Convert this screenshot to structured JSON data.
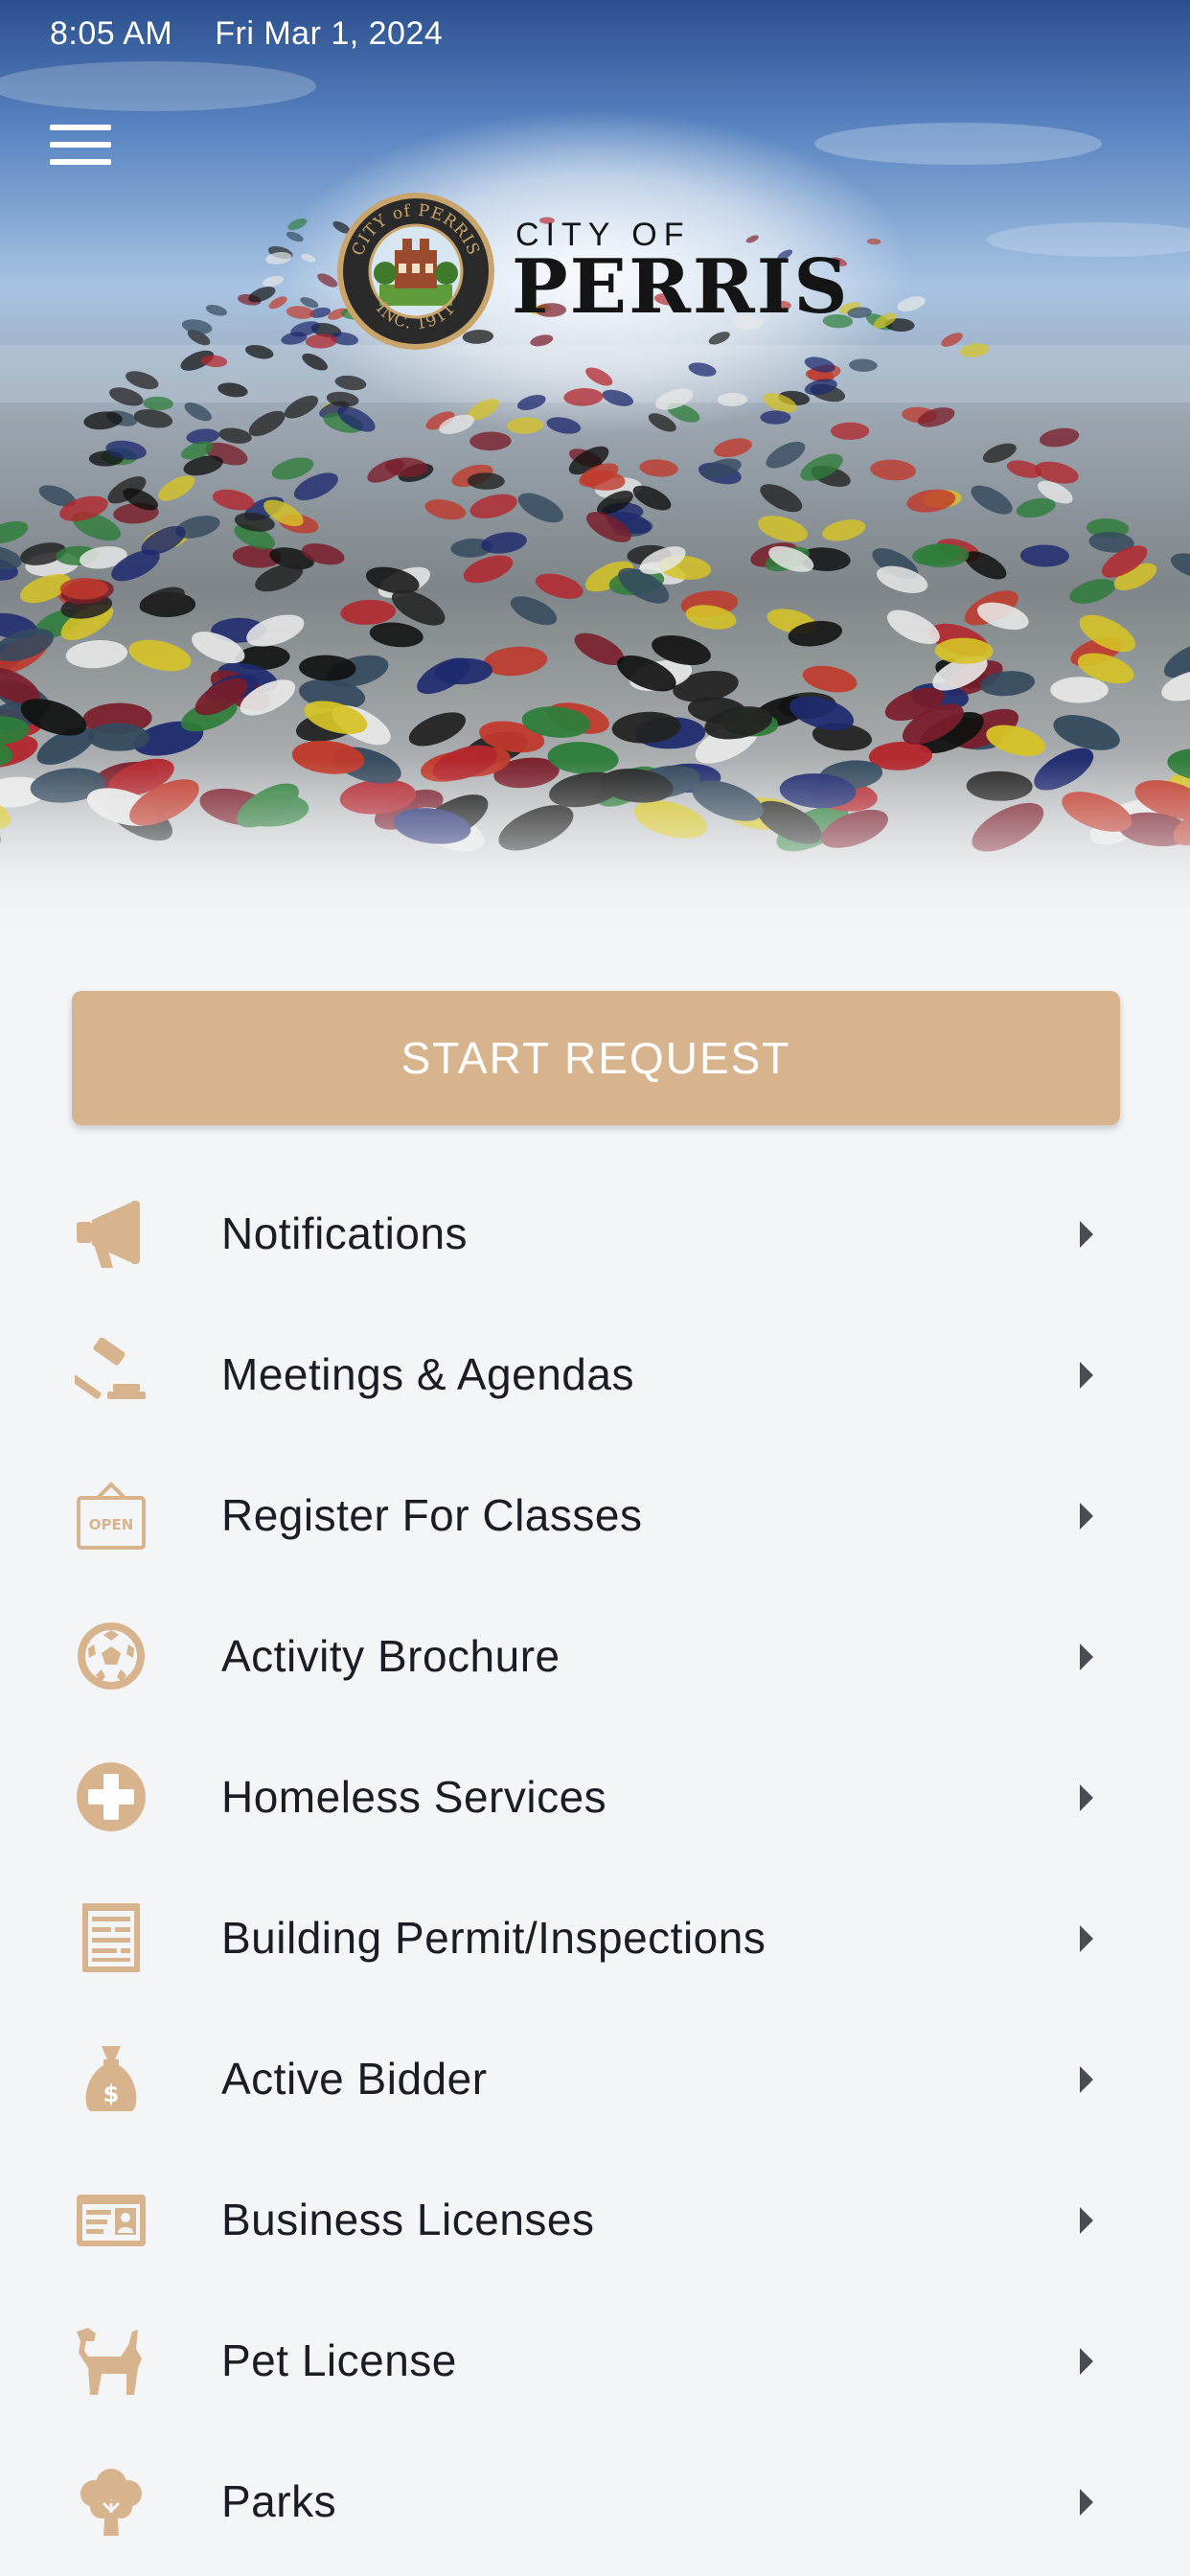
{
  "status_bar": {
    "time": "8:05 AM",
    "date": "Fri Mar 1, 2024"
  },
  "header": {
    "menu_icon": "hamburger-menu-icon",
    "logo": {
      "small_text": "CITY OF",
      "name": "PERRIS",
      "seal_text": "CITY of PERRIS INC. 1911"
    }
  },
  "actions": {
    "start_request": "START REQUEST"
  },
  "menu": {
    "items": [
      {
        "label": "Notifications",
        "icon": "megaphone-icon"
      },
      {
        "label": "Meetings & Agendas",
        "icon": "gavel-icon"
      },
      {
        "label": "Register For Classes",
        "icon": "open-sign-icon"
      },
      {
        "label": "Activity Brochure",
        "icon": "soccer-ball-icon"
      },
      {
        "label": "Homeless Services",
        "icon": "plus-circle-icon"
      },
      {
        "label": "Building Permit/Inspections",
        "icon": "document-icon"
      },
      {
        "label": "Active Bidder",
        "icon": "money-bag-icon"
      },
      {
        "label": "Business Licenses",
        "icon": "id-card-icon"
      },
      {
        "label": "Pet License",
        "icon": "dog-icon"
      },
      {
        "label": "Parks",
        "icon": "tree-icon"
      }
    ]
  },
  "colors": {
    "accent": "#d8b48e",
    "background": "#f4f5f7",
    "text": "#1b1d24"
  }
}
